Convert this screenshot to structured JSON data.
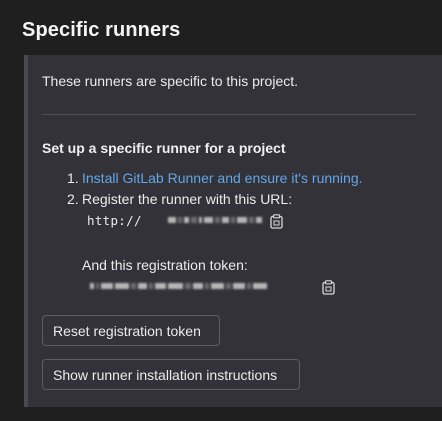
{
  "page": {
    "title": "Specific runners"
  },
  "panel": {
    "intro": "These runners are specific to this project.",
    "heading": "Set up a specific runner for a project",
    "steps": [
      {
        "number": "1.",
        "link_text": "Install GitLab Runner and ensure it's running."
      },
      {
        "number": "2.",
        "text": "Register the runner with this URL:"
      }
    ],
    "url_prefix": "http://",
    "token_label": "And this registration token:",
    "buttons": {
      "reset": "Reset registration token",
      "show_instructions": "Show runner installation instructions"
    }
  },
  "icons": {
    "copy_url": "copy-to-clipboard-icon",
    "copy_token": "copy-to-clipboard-icon"
  },
  "colors": {
    "background": "#1f1f1f",
    "panel": "#333238",
    "panel_border": "#4a4950",
    "link": "#63a6e9",
    "text": "#ececec"
  }
}
